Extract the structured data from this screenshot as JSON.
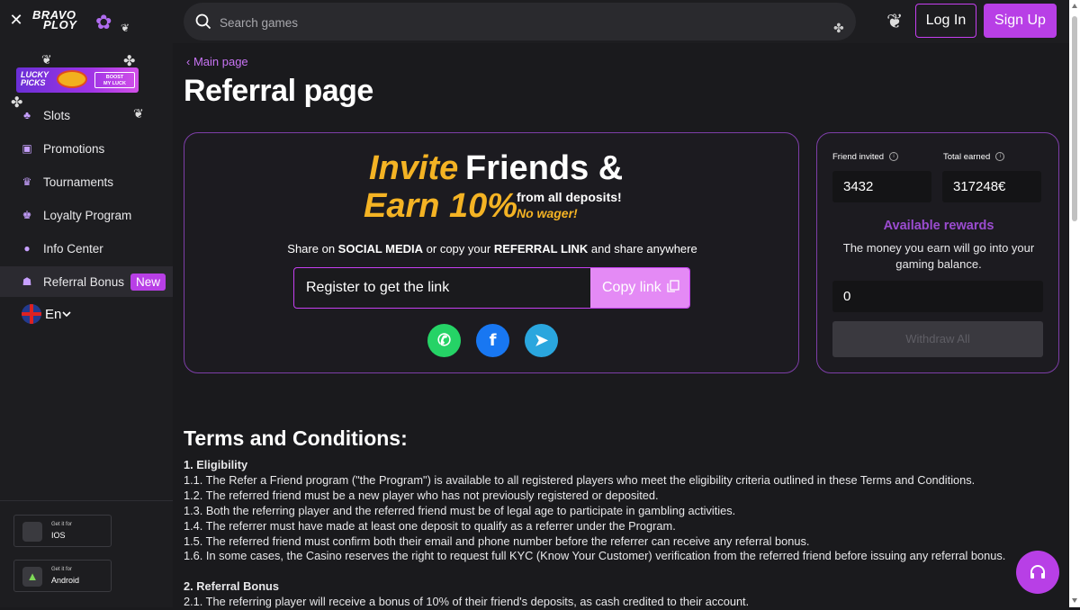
{
  "header": {
    "logo_line1": "BRAVO",
    "logo_line2": "PLOY",
    "search_placeholder": "Search games",
    "login_label": "Log In",
    "signup_label": "Sign Up"
  },
  "sidebar": {
    "promo": {
      "line1": "LUCKY",
      "line2": "PICKS",
      "boost1": "BOOST",
      "boost2": "MY LUCK"
    },
    "items": [
      {
        "label": "Slots",
        "icon": "cherries-icon"
      },
      {
        "label": "Promotions",
        "icon": "gift-icon"
      },
      {
        "label": "Tournaments",
        "icon": "trophy-icon"
      },
      {
        "label": "Loyalty Program",
        "icon": "crown-icon"
      },
      {
        "label": "Info Center",
        "icon": "info-icon"
      },
      {
        "label": "Referral Bonus",
        "icon": "users-icon",
        "badge": "New",
        "active": true
      }
    ],
    "language": "En",
    "stores": [
      {
        "get": "Get it for",
        "name": "IOS",
        "icon": "apple-icon"
      },
      {
        "get": "Get it for",
        "name": "Android",
        "icon": "android-icon"
      }
    ]
  },
  "main": {
    "breadcrumb": "Main page",
    "title": "Referral page",
    "hero": {
      "invite": "Invite",
      "friends": "Friends &",
      "earn": "Earn 10%",
      "from_all": "from all deposits!",
      "no_wager": "No wager!",
      "share_prefix": "Share on ",
      "share_social": "SOCIAL MEDIA",
      "share_mid": " or copy your ",
      "share_link": "REFERRAL LINK",
      "share_suffix": " and share anywhere",
      "link_value": "Register to get the link",
      "copy_label": "Copy link"
    },
    "stats": {
      "friend_invited_label": "Friend invited",
      "total_earned_label": "Total earned",
      "friend_invited_value": "3432",
      "total_earned_value": "317248€",
      "available_title": "Available rewards",
      "available_desc": "The money you earn will go into your gaming balance.",
      "balance_value": "0",
      "withdraw_label": "Withdraw All"
    },
    "terms": {
      "heading": "Terms and Conditions:",
      "s1_title": "1. Eligibility",
      "s1_lines": [
        "1.1. The Refer a Friend program (\"the Program\") is available to all registered players who meet the eligibility criteria outlined in these Terms and Conditions.",
        "1.2. The referred friend must be a new player who has not previously registered or deposited.",
        "1.3. Both the referring player and the referred friend must be of legal age to participate in gambling activities.",
        "1.4. The referrer must have made at least one deposit to qualify as a referrer under the Program.",
        "1.5. The referred friend must confirm both their email and phone number before the referrer can receive any referral bonus.",
        "1.6. In some cases, the Casino reserves the right to request full KYC (Know Your Customer) verification from the referred friend before issuing any referral bonus."
      ],
      "s2_title": "2. Referral Bonus",
      "s2_lines": [
        "2.1. The referring player will receive a bonus of 10% of their friend's deposits, as cash credited to their account."
      ]
    }
  },
  "colors": {
    "accent": "#b83fe6",
    "gold": "#f4b324",
    "card_border": "#7d3ea8",
    "whatsapp": "#25d366",
    "facebook": "#1877f2",
    "telegram": "#2aa6de"
  }
}
